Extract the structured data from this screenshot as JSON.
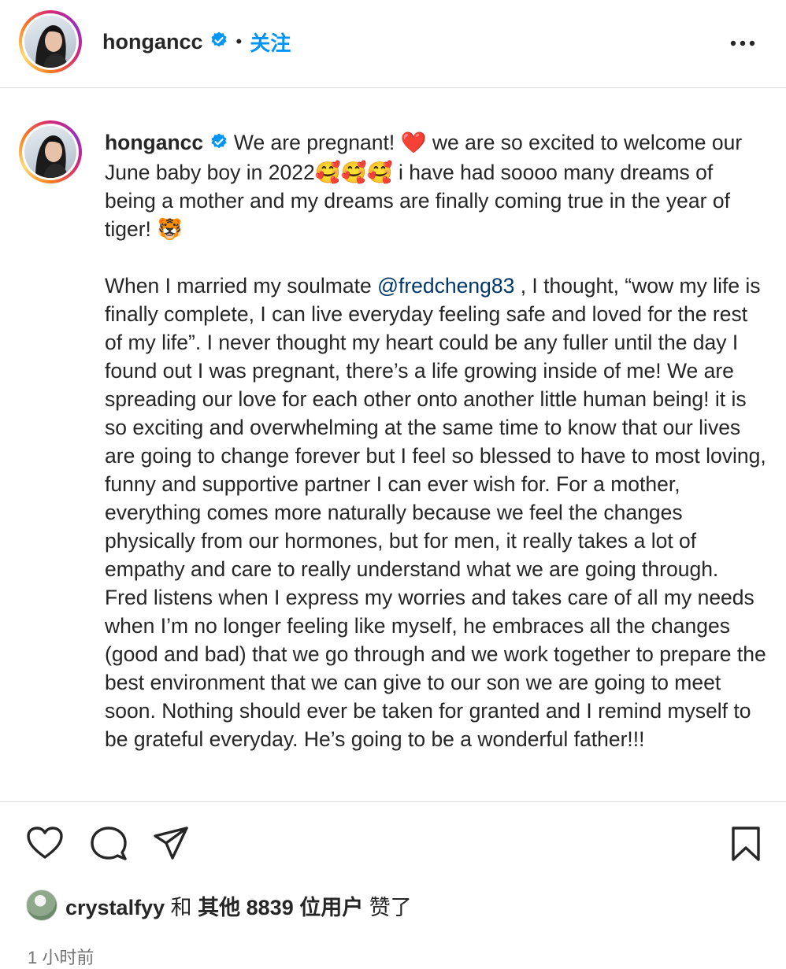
{
  "header": {
    "username": "hongancc",
    "separator": "•",
    "follow_label": "关注"
  },
  "post": {
    "username": "hongancc",
    "caption_para1": "We are pregnant! ❤️ we are so excited to welcome our June baby boy in 2022🥰🥰🥰 i have had soooo many dreams of being a mother and my dreams are finally coming true in the year of tiger! 🐯",
    "caption_para2_before": "When I married my soulmate ",
    "mention": "@fredcheng83",
    "caption_para2_after": " , I thought, “wow my life is finally complete, I can live everyday feeling safe and loved for the rest of my life”. I never thought my heart could be any fuller until the day I found out I was pregnant, there’s a life growing inside of me! We are spreading our love for each other onto another little human being! it is so exciting and overwhelming at the same time to know that our lives are going to change forever but I feel so blessed to have to most loving, funny and supportive partner I can ever wish for. For a mother, everything comes more naturally because we feel the changes physically from our hormones, but for men, it really takes a lot of empathy and care to really understand what we are going through. Fred listens when I express my worries and takes care of all my needs when I’m no longer feeling like myself, he embraces all the changes (good and bad) that we go through and we work together to prepare the best environment that we can give to our son we are going to meet soon. Nothing should ever be taken for granted and I remind myself to be grateful everyday. He’s going to be a wonderful father!!!"
  },
  "likes": {
    "liker": "crystalfyy",
    "conjunction": "和",
    "others_prefix": "其他",
    "count": "8839",
    "others_suffix": "位用户",
    "liked_text": "赞了"
  },
  "timestamp": "1 小时前",
  "icons": {
    "verified": "verified-badge-icon",
    "more": "more-options-icon",
    "like": "heart-icon",
    "comment": "comment-icon",
    "share": "share-icon",
    "save": "bookmark-icon"
  },
  "colors": {
    "accent": "#0095f6",
    "verified": "#0095f6",
    "mention": "#00376b",
    "secondary_text": "#737373",
    "border": "#dbdbdb"
  }
}
